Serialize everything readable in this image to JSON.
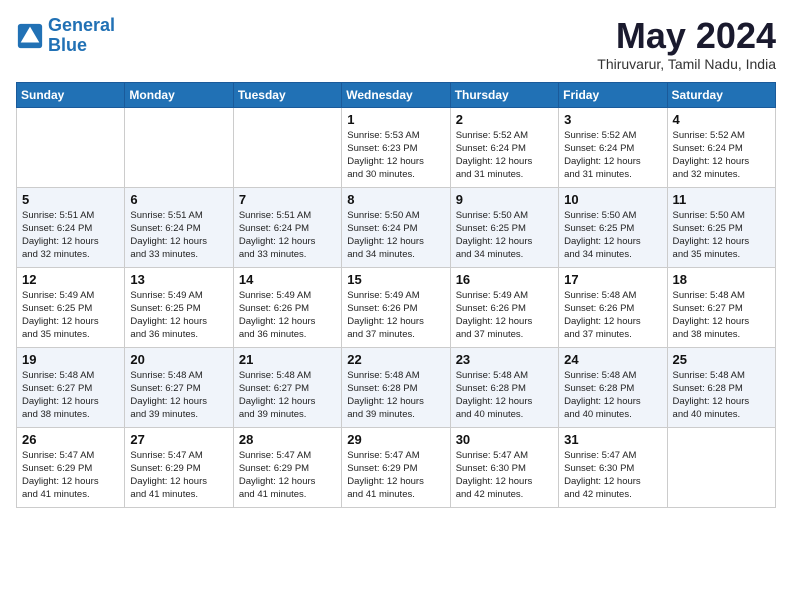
{
  "header": {
    "logo_line1": "General",
    "logo_line2": "Blue",
    "month_title": "May 2024",
    "location": "Thiruvarur, Tamil Nadu, India"
  },
  "days_of_week": [
    "Sunday",
    "Monday",
    "Tuesday",
    "Wednesday",
    "Thursday",
    "Friday",
    "Saturday"
  ],
  "weeks": [
    [
      {
        "num": "",
        "info": ""
      },
      {
        "num": "",
        "info": ""
      },
      {
        "num": "",
        "info": ""
      },
      {
        "num": "1",
        "info": "Sunrise: 5:53 AM\nSunset: 6:23 PM\nDaylight: 12 hours\nand 30 minutes."
      },
      {
        "num": "2",
        "info": "Sunrise: 5:52 AM\nSunset: 6:24 PM\nDaylight: 12 hours\nand 31 minutes."
      },
      {
        "num": "3",
        "info": "Sunrise: 5:52 AM\nSunset: 6:24 PM\nDaylight: 12 hours\nand 31 minutes."
      },
      {
        "num": "4",
        "info": "Sunrise: 5:52 AM\nSunset: 6:24 PM\nDaylight: 12 hours\nand 32 minutes."
      }
    ],
    [
      {
        "num": "5",
        "info": "Sunrise: 5:51 AM\nSunset: 6:24 PM\nDaylight: 12 hours\nand 32 minutes."
      },
      {
        "num": "6",
        "info": "Sunrise: 5:51 AM\nSunset: 6:24 PM\nDaylight: 12 hours\nand 33 minutes."
      },
      {
        "num": "7",
        "info": "Sunrise: 5:51 AM\nSunset: 6:24 PM\nDaylight: 12 hours\nand 33 minutes."
      },
      {
        "num": "8",
        "info": "Sunrise: 5:50 AM\nSunset: 6:24 PM\nDaylight: 12 hours\nand 34 minutes."
      },
      {
        "num": "9",
        "info": "Sunrise: 5:50 AM\nSunset: 6:25 PM\nDaylight: 12 hours\nand 34 minutes."
      },
      {
        "num": "10",
        "info": "Sunrise: 5:50 AM\nSunset: 6:25 PM\nDaylight: 12 hours\nand 34 minutes."
      },
      {
        "num": "11",
        "info": "Sunrise: 5:50 AM\nSunset: 6:25 PM\nDaylight: 12 hours\nand 35 minutes."
      }
    ],
    [
      {
        "num": "12",
        "info": "Sunrise: 5:49 AM\nSunset: 6:25 PM\nDaylight: 12 hours\nand 35 minutes."
      },
      {
        "num": "13",
        "info": "Sunrise: 5:49 AM\nSunset: 6:25 PM\nDaylight: 12 hours\nand 36 minutes."
      },
      {
        "num": "14",
        "info": "Sunrise: 5:49 AM\nSunset: 6:26 PM\nDaylight: 12 hours\nand 36 minutes."
      },
      {
        "num": "15",
        "info": "Sunrise: 5:49 AM\nSunset: 6:26 PM\nDaylight: 12 hours\nand 37 minutes."
      },
      {
        "num": "16",
        "info": "Sunrise: 5:49 AM\nSunset: 6:26 PM\nDaylight: 12 hours\nand 37 minutes."
      },
      {
        "num": "17",
        "info": "Sunrise: 5:48 AM\nSunset: 6:26 PM\nDaylight: 12 hours\nand 37 minutes."
      },
      {
        "num": "18",
        "info": "Sunrise: 5:48 AM\nSunset: 6:27 PM\nDaylight: 12 hours\nand 38 minutes."
      }
    ],
    [
      {
        "num": "19",
        "info": "Sunrise: 5:48 AM\nSunset: 6:27 PM\nDaylight: 12 hours\nand 38 minutes."
      },
      {
        "num": "20",
        "info": "Sunrise: 5:48 AM\nSunset: 6:27 PM\nDaylight: 12 hours\nand 39 minutes."
      },
      {
        "num": "21",
        "info": "Sunrise: 5:48 AM\nSunset: 6:27 PM\nDaylight: 12 hours\nand 39 minutes."
      },
      {
        "num": "22",
        "info": "Sunrise: 5:48 AM\nSunset: 6:28 PM\nDaylight: 12 hours\nand 39 minutes."
      },
      {
        "num": "23",
        "info": "Sunrise: 5:48 AM\nSunset: 6:28 PM\nDaylight: 12 hours\nand 40 minutes."
      },
      {
        "num": "24",
        "info": "Sunrise: 5:48 AM\nSunset: 6:28 PM\nDaylight: 12 hours\nand 40 minutes."
      },
      {
        "num": "25",
        "info": "Sunrise: 5:48 AM\nSunset: 6:28 PM\nDaylight: 12 hours\nand 40 minutes."
      }
    ],
    [
      {
        "num": "26",
        "info": "Sunrise: 5:47 AM\nSunset: 6:29 PM\nDaylight: 12 hours\nand 41 minutes."
      },
      {
        "num": "27",
        "info": "Sunrise: 5:47 AM\nSunset: 6:29 PM\nDaylight: 12 hours\nand 41 minutes."
      },
      {
        "num": "28",
        "info": "Sunrise: 5:47 AM\nSunset: 6:29 PM\nDaylight: 12 hours\nand 41 minutes."
      },
      {
        "num": "29",
        "info": "Sunrise: 5:47 AM\nSunset: 6:29 PM\nDaylight: 12 hours\nand 41 minutes."
      },
      {
        "num": "30",
        "info": "Sunrise: 5:47 AM\nSunset: 6:30 PM\nDaylight: 12 hours\nand 42 minutes."
      },
      {
        "num": "31",
        "info": "Sunrise: 5:47 AM\nSunset: 6:30 PM\nDaylight: 12 hours\nand 42 minutes."
      },
      {
        "num": "",
        "info": ""
      }
    ]
  ]
}
